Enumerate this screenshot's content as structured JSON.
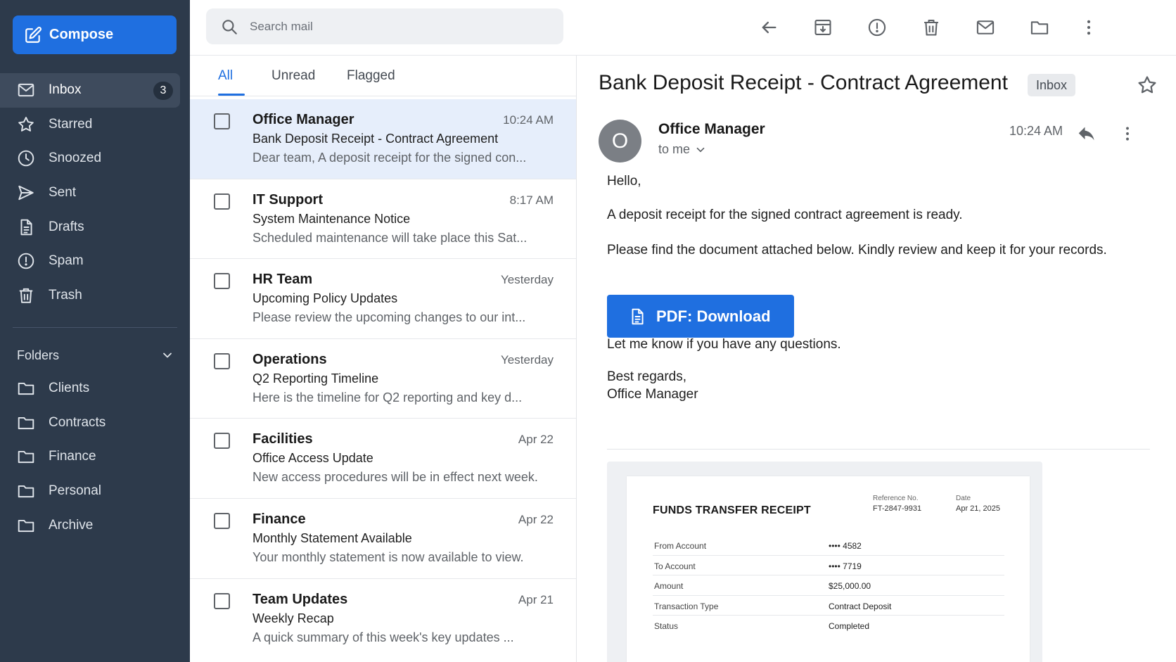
{
  "sidebar": {
    "compose_label": "Compose",
    "nav": [
      {
        "label": "Inbox",
        "icon": "mail-icon",
        "badge": "3",
        "active": true
      },
      {
        "label": "Starred",
        "icon": "star-icon"
      },
      {
        "label": "Snoozed",
        "icon": "clock-icon"
      },
      {
        "label": "Sent",
        "icon": "send-icon"
      },
      {
        "label": "Drafts",
        "icon": "draft-icon"
      },
      {
        "label": "Spam",
        "icon": "alert-icon"
      },
      {
        "label": "Trash",
        "icon": "trash-icon"
      }
    ],
    "folders_label": "Folders",
    "folders": [
      "Clients",
      "Contracts",
      "Finance",
      "Personal",
      "Archive"
    ]
  },
  "search": {
    "placeholder": "Search mail"
  },
  "toolbar": {
    "icons": [
      "back-arrow-icon",
      "archive-icon",
      "report-spam-icon",
      "delete-icon",
      "mark-unread-icon",
      "move-to-folder-icon",
      "more-vert-icon"
    ]
  },
  "list": {
    "tabs": [
      "All",
      "Unread",
      "Flagged"
    ],
    "active_tab": "All",
    "messages": [
      {
        "sender": "Office Manager",
        "time": "10:24 AM",
        "subject": "Bank Deposit Receipt - Contract Agreement",
        "snippet": "Dear team, A deposit receipt for the signed con...",
        "selected": true
      },
      {
        "sender": "IT Support",
        "time": "8:17 AM",
        "subject": "System Maintenance Notice",
        "snippet": "Scheduled maintenance will take place this Sat..."
      },
      {
        "sender": "HR Team",
        "time": "Yesterday",
        "subject": "Upcoming Policy Updates",
        "snippet": "Please review the upcoming changes to our int..."
      },
      {
        "sender": "Operations",
        "time": "Yesterday",
        "subject": "Q2 Reporting Timeline",
        "snippet": "Here is the timeline for Q2 reporting and key d..."
      },
      {
        "sender": "Facilities",
        "time": "Apr 22",
        "subject": "Office Access Update",
        "snippet": "New access procedures will be in effect next week."
      },
      {
        "sender": "Finance",
        "time": "Apr 22",
        "subject": "Monthly Statement Available",
        "snippet": "Your monthly statement is now available to view."
      },
      {
        "sender": "Team Updates",
        "time": "Apr 21",
        "subject": "Weekly Recap",
        "snippet": "A quick summary of this week's key updates ..."
      }
    ]
  },
  "message": {
    "subject": "Bank Deposit Receipt - Contract Agreement",
    "label_chip": "Inbox",
    "avatar_letter": "O",
    "from": "Office Manager",
    "to": "to me",
    "time": "10:24 AM",
    "greeting": "Hello,",
    "line1": "A deposit receipt for the signed contract agreement is ready.",
    "line2": "Please find the document attached below. Kindly review and keep it for your records.",
    "button_label": "PDF: Download",
    "line3": "Let me know if you have any questions.",
    "signoff": "Best regards,",
    "signature": "Office Manager"
  },
  "receipt": {
    "title": "FUNDS TRANSFER RECEIPT",
    "ref_label": "Reference No.",
    "ref_value": "FT-2847-9931",
    "date_label": "Date",
    "date_value": "Apr 21, 2025",
    "rows": [
      {
        "k": "From Account",
        "v": "•••• 4582"
      },
      {
        "k": "To Account",
        "v": "•••• 7719"
      },
      {
        "k": "Amount",
        "v": "$25,000.00"
      },
      {
        "k": "Transaction Type",
        "v": "Contract Deposit"
      },
      {
        "k": "Status",
        "v": "Completed"
      }
    ]
  },
  "colors": {
    "sidebar_bg": "#2d3a4b",
    "accent": "#1f6fe0",
    "selected_row": "#e6eefb"
  }
}
